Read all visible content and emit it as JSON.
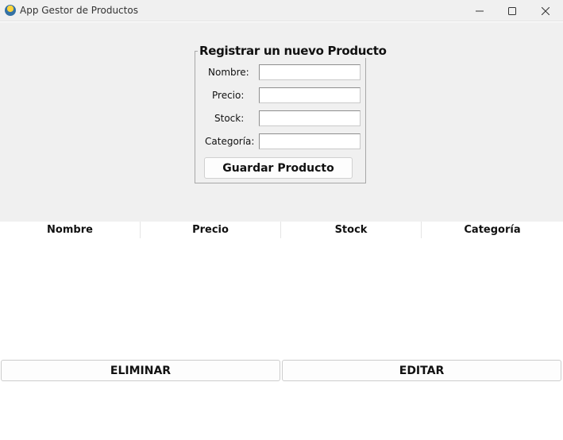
{
  "window": {
    "title": "App Gestor de Productos",
    "icon": "python-feather-icon",
    "controls": [
      "minimize-icon",
      "maximize-icon",
      "close-icon"
    ]
  },
  "form": {
    "legend": "Registrar un nuevo Producto",
    "fields": {
      "nombre": {
        "label": "Nombre:",
        "value": ""
      },
      "precio": {
        "label": "Precio:",
        "value": ""
      },
      "stock": {
        "label": "Stock:",
        "value": ""
      },
      "categoria": {
        "label": "Categoría:",
        "value": ""
      }
    },
    "submit_label": "Guardar Producto"
  },
  "table": {
    "columns": [
      "Nombre",
      "Precio",
      "Stock",
      "Categoría"
    ],
    "rows": []
  },
  "actions": {
    "delete_label": "ELIMINAR",
    "edit_label": "EDITAR"
  },
  "colors": {
    "panel_bg": "#f0f0f0",
    "content_bg": "#ffffff",
    "border": "#a8a8a8"
  }
}
